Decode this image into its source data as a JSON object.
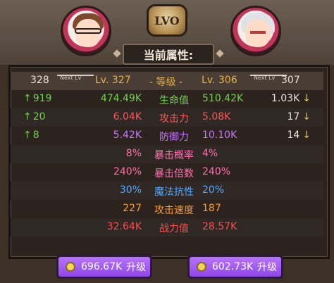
{
  "header": {
    "level_badge": "LVO",
    "title": "当前属性:"
  },
  "level_row": {
    "player_next_lv": "328",
    "next_lv_label": "Next Lv",
    "player_lv": "Lv. 327",
    "mid_label": "- 等级 -",
    "opponent_lv": "Lv. 306",
    "opponent_next_lv": "307"
  },
  "stats": [
    {
      "up": "919",
      "player": "474.49K",
      "label": "生命值",
      "opponent": "510.42K",
      "opp_up": "1.03K",
      "color": "#6fd24b"
    },
    {
      "up": "20",
      "player": "6.04K",
      "label": "攻击力",
      "opponent": "5.08K",
      "opp_up": "17",
      "color": "#ff5656"
    },
    {
      "up": "8",
      "player": "5.42K",
      "label": "防御力",
      "opponent": "10.10K",
      "opp_up": "14",
      "color": "#c474ff"
    },
    {
      "player": "8%",
      "label": "暴击概率",
      "opponent": "4%",
      "color": "#ff6fae"
    },
    {
      "player": "240%",
      "label": "暴击倍数",
      "opponent": "240%",
      "color": "#ff6fae"
    },
    {
      "player": "30%",
      "label": "魔法抗性",
      "opponent": "20%",
      "color": "#55aaff"
    },
    {
      "player": "227",
      "label": "攻击速度",
      "opponent": "187",
      "color": "#ff9a2e"
    },
    {
      "player": "32.64K",
      "label": "战力值",
      "opponent": "28.57K",
      "color": "#ff4b4b"
    }
  ],
  "buttons": {
    "left_cost": "696.67K",
    "right_cost": "602.73K",
    "upgrade": "升级"
  },
  "colors": {
    "upgrade_button": "#a25cf2",
    "up_arrow": "#6fd24b",
    "level_text": "#e5b347"
  }
}
